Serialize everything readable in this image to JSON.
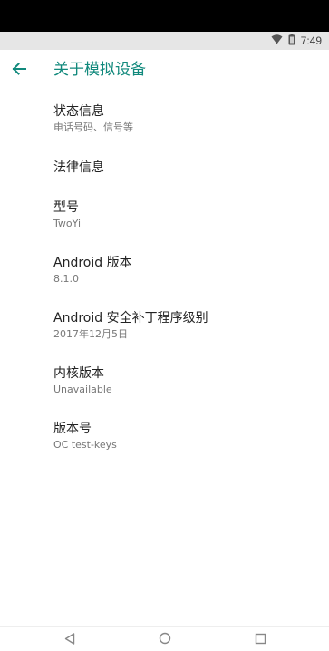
{
  "status_bar": {
    "time": "7:49",
    "icons": [
      "wifi-icon",
      "battery-icon"
    ]
  },
  "app_bar": {
    "back_icon": "arrow-left-icon",
    "title": "关于模拟设备",
    "accent_color": "#11897c"
  },
  "items": [
    {
      "title": "状态信息",
      "summary": "电话号码、信号等"
    },
    {
      "title": "法律信息",
      "summary": ""
    },
    {
      "title": "型号",
      "summary": "TwoYi"
    },
    {
      "title": "Android 版本",
      "summary": "8.1.0"
    },
    {
      "title": "Android 安全补丁程序级别",
      "summary": "2017年12月5日"
    },
    {
      "title": "内核版本",
      "summary": "Unavailable"
    },
    {
      "title": "版本号",
      "summary": "OC test-keys"
    }
  ],
  "nav_bar": {
    "buttons": [
      "back-triangle-icon",
      "home-circle-icon",
      "recents-square-icon"
    ]
  }
}
